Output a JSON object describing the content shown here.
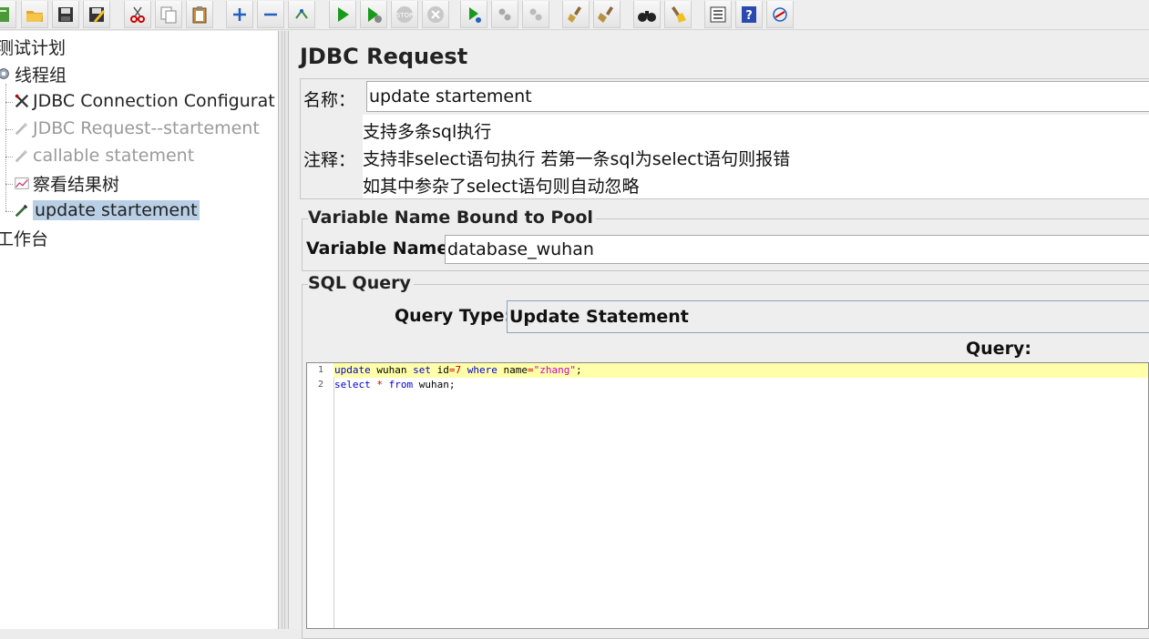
{
  "toolbar": {
    "buttons": [
      "templates",
      "open",
      "save",
      "save-as",
      "cut",
      "copy",
      "paste",
      "expand",
      "collapse",
      "toggle",
      "start",
      "start-no-pause",
      "stop",
      "shutdown",
      "remote-start",
      "remote-stop",
      "remote-exit",
      "clear",
      "clear-all",
      "search",
      "reset-search",
      "function-helper",
      "help",
      "log-viewer"
    ]
  },
  "tree": {
    "root": "测试计划",
    "thread_group": "线程组",
    "items": [
      {
        "label": "JDBC Connection Configurat",
        "enabled": true
      },
      {
        "label": "JDBC Request--startement",
        "enabled": false
      },
      {
        "label": "callable statement",
        "enabled": false
      },
      {
        "label": "察看结果树",
        "enabled": true
      },
      {
        "label": "update startement",
        "enabled": true,
        "selected": true
      }
    ],
    "workbench": "工作台"
  },
  "panel": {
    "title": "JDBC Request",
    "name_label": "名称：",
    "name_value": "update startement",
    "comment_label": "注释：",
    "comment_lines": [
      "支持多条sql执行",
      "支持非select语句执行 若第一条sql为select语句则报错",
      "如其中参杂了select语句则自动忽略"
    ],
    "pool_group_title": "Variable Name Bound to Pool",
    "variable_name_label": "Variable Name:",
    "variable_name_value": "database_wuhan",
    "sql_group_title": "SQL Query",
    "query_type_label": "Query Type:",
    "query_type_value": "Update Statement",
    "query_label": "Query:",
    "code_lines": [
      "update wuhan set id=7 where name=\"zhang\";",
      "select * from wuhan;"
    ],
    "line_numbers": [
      "1",
      "2"
    ]
  },
  "colors": {
    "selection": "#b8cfe5",
    "current_line": "#ffffaa",
    "keyword": "#0000cc"
  }
}
